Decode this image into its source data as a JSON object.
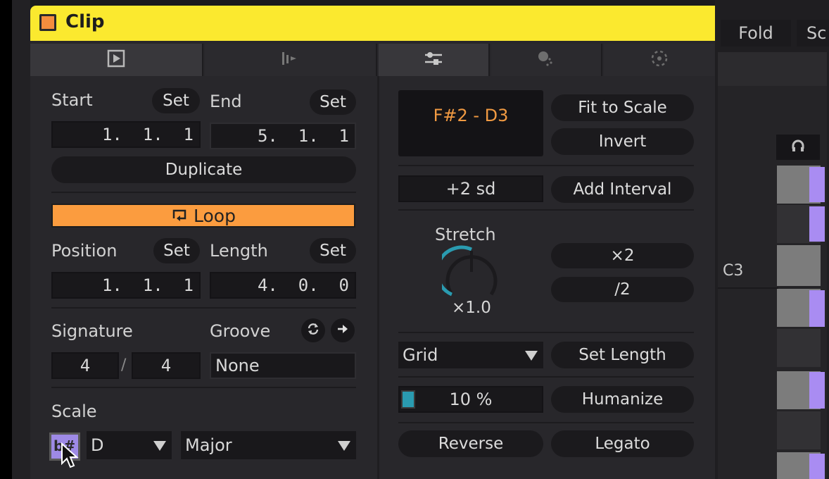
{
  "window": {
    "title": "Clip",
    "title_color": "#fbe92f",
    "clip_color": "#f48d3e"
  },
  "tabs_left": [
    {
      "name": "clip-tab",
      "icon": "play-box-icon",
      "active": true
    },
    {
      "name": "note-expression-tab",
      "icon": "bars-play-icon",
      "active": false
    }
  ],
  "tabs_right": [
    {
      "name": "transform-tools-tab",
      "icon": "sliders-icon",
      "active": true
    },
    {
      "name": "generators-tab",
      "icon": "dot-sphere-icon",
      "active": false
    },
    {
      "name": "effects-tab",
      "icon": "dotted-circle-icon",
      "active": false
    }
  ],
  "clip": {
    "start_label": "Start",
    "start_set": "Set",
    "start_value": "1.  1.  1",
    "end_label": "End",
    "end_set": "Set",
    "end_value": "5.  1.  1",
    "duplicate": "Duplicate",
    "loop": "Loop",
    "loop_color": "#fb9c3f",
    "position_label": "Position",
    "position_set": "Set",
    "position_value": "1.  1.  1",
    "length_label": "Length",
    "length_set": "Set",
    "length_value": "4.  0.  0",
    "signature_label": "Signature",
    "signature_num": "4",
    "signature_sep": "/",
    "signature_den": "4",
    "groove_label": "Groove",
    "groove_value": "None",
    "scale_label": "Scale",
    "scale_root": "D",
    "scale_mode": "Major",
    "scale_toggle_glyph": "b#"
  },
  "transform": {
    "range": "F#2 - D3",
    "range_color": "#f19a42",
    "fit_to_scale": "Fit to Scale",
    "invert": "Invert",
    "interval_value": "+2 sd",
    "add_interval": "Add Interval",
    "stretch_label": "Stretch",
    "stretch_value": "×1.0",
    "stretch_knob_color": "#2a9bb0",
    "times_two": "×2",
    "div_two": "/2",
    "grid_mode": "Grid",
    "set_length": "Set Length",
    "humanize_amount": "10 %",
    "humanize_fraction": 0.1,
    "humanize": "Humanize",
    "reverse": "Reverse",
    "legato": "Legato"
  },
  "piano_roll": {
    "fold": "Fold",
    "scale_button_partial": "Sc",
    "note_label": "C3",
    "note_color": "#a98cf2"
  }
}
